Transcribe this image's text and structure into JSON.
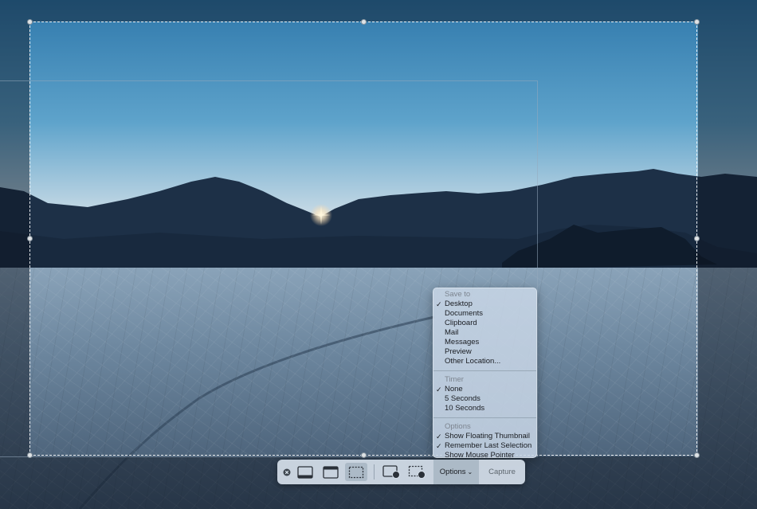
{
  "options_menu": {
    "sections": [
      {
        "title": "Save to",
        "items": [
          {
            "label": "Desktop",
            "checked": true
          },
          {
            "label": "Documents",
            "checked": false
          },
          {
            "label": "Clipboard",
            "checked": false
          },
          {
            "label": "Mail",
            "checked": false
          },
          {
            "label": "Messages",
            "checked": false
          },
          {
            "label": "Preview",
            "checked": false
          },
          {
            "label": "Other Location...",
            "checked": false
          }
        ]
      },
      {
        "title": "Timer",
        "items": [
          {
            "label": "None",
            "checked": true
          },
          {
            "label": "5 Seconds",
            "checked": false
          },
          {
            "label": "10 Seconds",
            "checked": false
          }
        ]
      },
      {
        "title": "Options",
        "items": [
          {
            "label": "Show Floating Thumbnail",
            "checked": true
          },
          {
            "label": "Remember Last Selection",
            "checked": true
          },
          {
            "label": "Show Mouse Pointer",
            "checked": false
          }
        ]
      }
    ]
  },
  "toolbar": {
    "tools": [
      {
        "name": "close-icon",
        "active": false
      },
      {
        "name": "capture-entire-screen-icon",
        "active": false
      },
      {
        "name": "capture-selected-window-icon",
        "active": false
      },
      {
        "name": "capture-selected-portion-icon",
        "active": true
      },
      {
        "name": "record-entire-screen-icon",
        "active": false
      },
      {
        "name": "record-selected-portion-icon",
        "active": false
      }
    ],
    "options_label": "Options",
    "capture_label": "Capture"
  },
  "colors": {
    "sky_top": "#3a86b8",
    "sky_horizon": "#f2dfe8",
    "mountains": "#1e3148",
    "playa": "#6f8aa3",
    "menu_background": "#c8d6e6",
    "toolbar_background": "#d6e0ea"
  }
}
